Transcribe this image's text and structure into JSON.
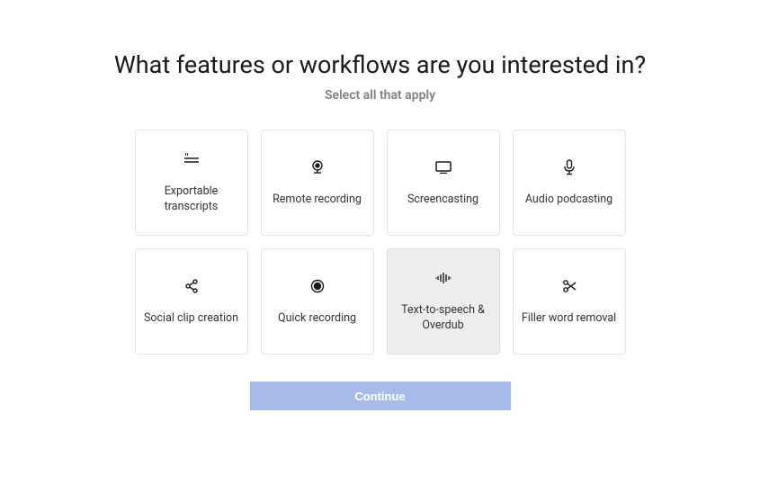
{
  "heading": "What features or workflows are you interested in?",
  "subheading": "Select all that apply",
  "options": [
    {
      "label": "Exportable transcripts",
      "icon": "transcript"
    },
    {
      "label": "Remote recording",
      "icon": "webcam"
    },
    {
      "label": "Screencasting",
      "icon": "monitor"
    },
    {
      "label": "Audio podcasting",
      "icon": "microphone"
    },
    {
      "label": "Social clip creation",
      "icon": "share"
    },
    {
      "label": "Quick recording",
      "icon": "record"
    },
    {
      "label": "Text-to-speech & Overdub",
      "icon": "audio-waves",
      "highlighted": true
    },
    {
      "label": "Filler word removal",
      "icon": "scissors"
    }
  ],
  "continue_label": "Continue"
}
